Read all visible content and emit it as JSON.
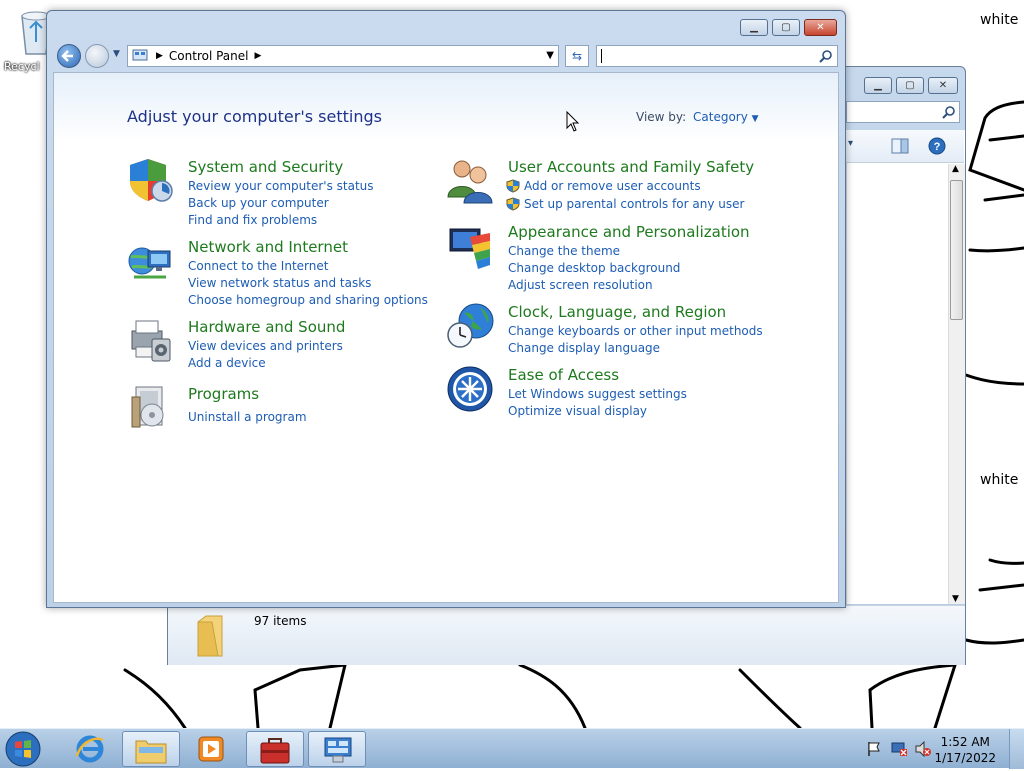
{
  "desktop": {
    "white_label_1": "white",
    "white_label_2": "white",
    "recycle_bin_label": "Recycl"
  },
  "background_window": {
    "status_text": "97 items"
  },
  "control_panel": {
    "breadcrumb": "Control Panel",
    "search_placeholder": "",
    "heading": "Adjust your computer's settings",
    "view_by_label": "View by:",
    "view_by_value": "Category",
    "categories_left": [
      {
        "title": "System and Security",
        "icon": "shield-icon",
        "links": [
          "Review your computer's status",
          "Back up your computer",
          "Find and fix problems"
        ]
      },
      {
        "title": "Network and Internet",
        "icon": "network-icon",
        "links": [
          "Connect to the Internet",
          "View network status and tasks",
          "Choose homegroup and sharing options"
        ]
      },
      {
        "title": "Hardware and Sound",
        "icon": "printer-icon",
        "links": [
          "View devices and printers",
          "Add a device"
        ]
      },
      {
        "title": "Programs",
        "icon": "programs-icon",
        "links": [
          "Uninstall a program"
        ]
      }
    ],
    "categories_right": [
      {
        "title": "User Accounts and Family Safety",
        "icon": "users-icon",
        "links": [
          "Add or remove user accounts",
          "Set up parental controls for any user"
        ]
      },
      {
        "title": "Appearance and Personalization",
        "icon": "appearance-icon",
        "links": [
          "Change the theme",
          "Change desktop background",
          "Adjust screen resolution"
        ]
      },
      {
        "title": "Clock, Language, and Region",
        "icon": "globe-clock-icon",
        "links": [
          "Change keyboards or other input methods",
          "Change display language"
        ]
      },
      {
        "title": "Ease of Access",
        "icon": "ease-of-access-icon",
        "links": [
          "Let Windows suggest settings",
          "Optimize visual display"
        ]
      }
    ]
  },
  "taskbar": {
    "time": "1:52 AM",
    "date": "1/17/2022"
  },
  "colors": {
    "category_title": "#1e7a1e",
    "link": "#1d5db3",
    "heading": "#1e3287"
  }
}
